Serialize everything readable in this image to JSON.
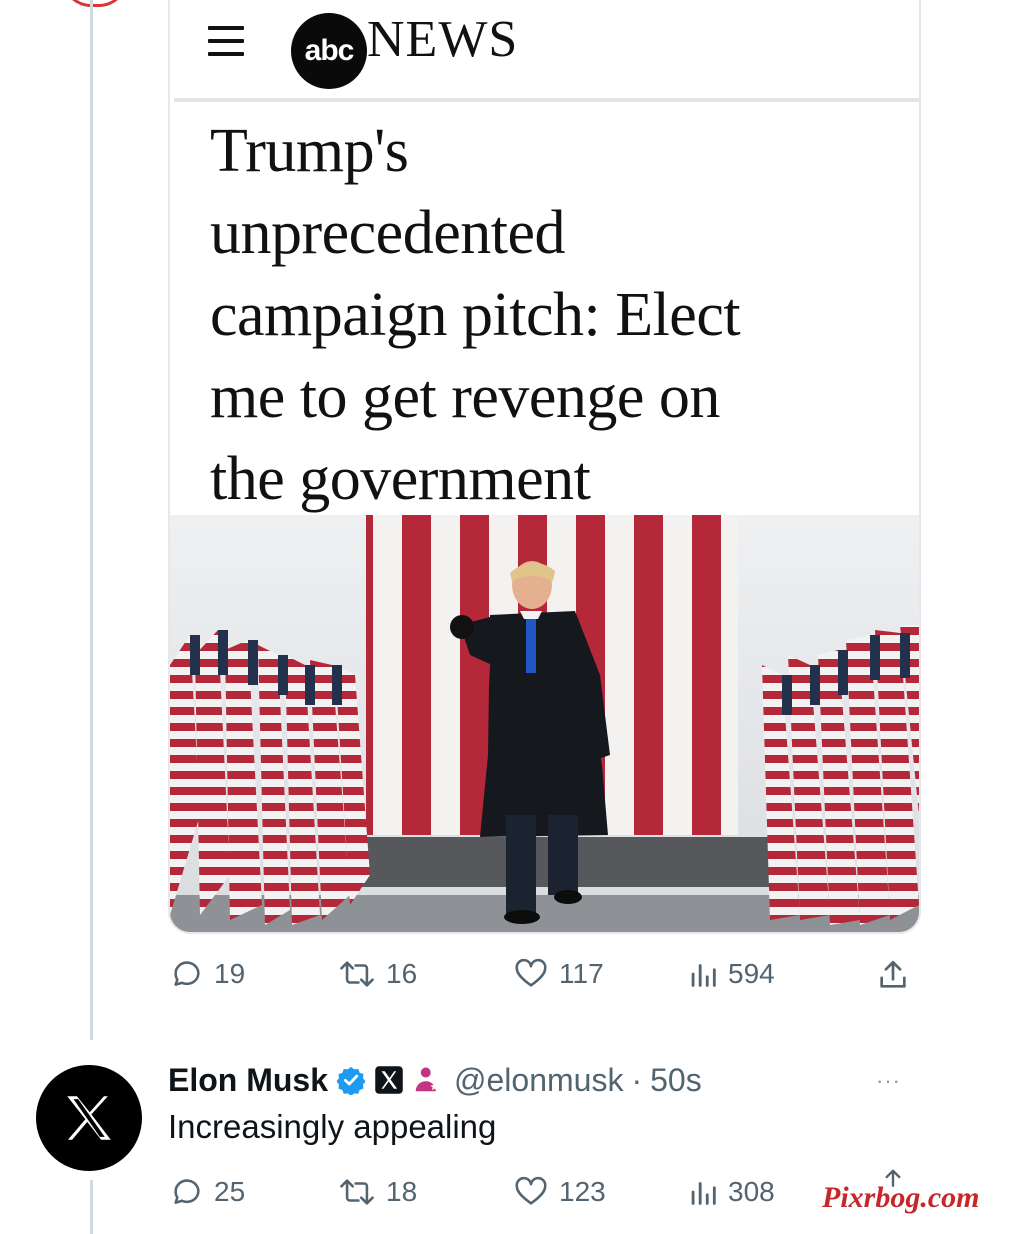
{
  "news": {
    "brand_abc": "abc",
    "brand_news": "NEWS",
    "headline_lines": [
      "Trump's",
      "unprecedented",
      "campaign pitch: Elect",
      "me to get revenge on",
      "the government"
    ]
  },
  "original_post": {
    "replies": "19",
    "reposts": "16",
    "likes": "117",
    "views": "594"
  },
  "reply": {
    "name": "Elon Musk",
    "handle": "@elonmusk",
    "separator": "·",
    "time": "50s",
    "text": "Increasingly appealing",
    "more": "···",
    "replies": "25",
    "reposts": "18",
    "likes": "123",
    "views": "308"
  },
  "watermark": "Pixrbog.com",
  "colors": {
    "verified": "#1d9bf0",
    "affiliate_badge": "#c13584",
    "flag_red": "#b4283a",
    "icon_gray": "#536471"
  },
  "icons": [
    "menu-icon",
    "comment-icon",
    "repost-icon",
    "heart-icon",
    "views-icon",
    "share-icon",
    "verified-icon",
    "x-logo-icon",
    "affiliate-icon"
  ]
}
